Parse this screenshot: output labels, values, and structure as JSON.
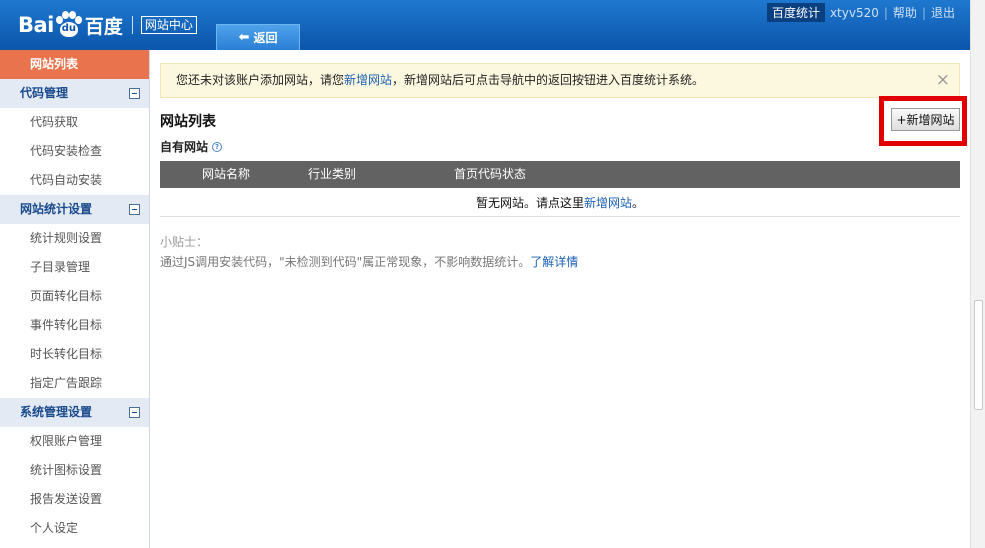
{
  "header": {
    "logo_bai": "Bai",
    "logo_du": "du",
    "logo_cn": "百度",
    "site_center": "网站中心",
    "back_label": "返回",
    "nav": {
      "current": "百度统计",
      "user": "xtyv520",
      "help": "帮助",
      "logout": "退出"
    }
  },
  "sidebar": {
    "active": "网站列表",
    "groups": [
      {
        "label": "代码管理",
        "items": [
          "代码获取",
          "代码安装检查",
          "代码自动安装"
        ]
      },
      {
        "label": "网站统计设置",
        "items": [
          "统计规则设置",
          "子目录管理",
          "页面转化目标",
          "事件转化目标",
          "时长转化目标",
          "指定广告跟踪"
        ]
      },
      {
        "label": "系统管理设置",
        "items": [
          "权限账户管理",
          "统计图标设置",
          "报告发送设置",
          "个人设定"
        ]
      }
    ]
  },
  "notice": {
    "text_before": "您还未对该账户添加网站，请您",
    "link": "新增网站",
    "text_after": "，新增网站后可点击导航中的返回按钮进入百度统计系统。",
    "close": "×"
  },
  "main": {
    "title": "网站列表",
    "add_button": "+新增网站",
    "own_sites": "自有网站",
    "help_icon": "?",
    "columns": [
      "网站名称",
      "行业类别",
      "首页代码状态"
    ],
    "empty_before": "暂无网站。请点这里",
    "empty_link": "新增网站",
    "empty_after": "。",
    "tips_title": "小贴士：",
    "tips_text": "通过JS调用安装代码，\"未检测到代码\"属正常现象，不影响数据统计。",
    "tips_link": "了解详情"
  },
  "colors": {
    "header": "#0b55ab",
    "active_item": "#e9734c",
    "highlight_box": "#e00000",
    "link": "#1a5fb4"
  }
}
